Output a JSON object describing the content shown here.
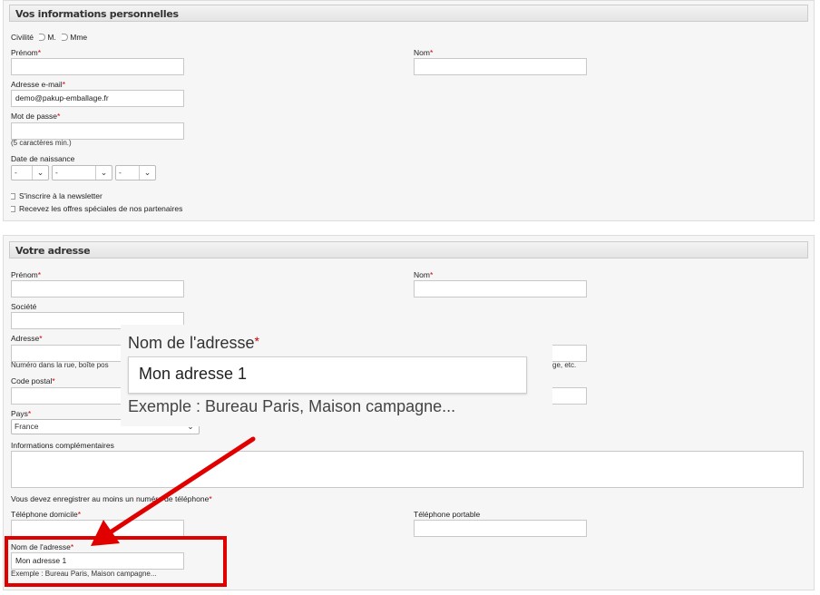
{
  "personal": {
    "header": "Vos informations personnelles",
    "civilite": "Civilité",
    "mr": "M.",
    "mme": "Mme",
    "prenom": "Prénom",
    "nom": "Nom",
    "email_label": "Adresse e-mail",
    "email_value": "demo@pakup-emballage.fr",
    "password_label": "Mot de passe",
    "password_hint": "(5 caractères min.)",
    "birth_label": "Date de naissance",
    "day": "-",
    "month": "-",
    "year": "-",
    "newsletter": "S'inscrire à la newsletter",
    "offers": "Recevez les offres spéciales de nos partenaires"
  },
  "address": {
    "header": "Votre adresse",
    "prenom": "Prénom",
    "nom": "Nom",
    "societe": "Société",
    "adresse": "Adresse",
    "adresse_hint": "Numéro dans la rue, boîte pos",
    "adresse2_hint_tail": "ge, etc.",
    "code_postal": "Code postal",
    "pays": "Pays",
    "pays_value": "France",
    "infos": "Informations complémentaires",
    "phone_note": "Vous devez enregistrer au moins un numéro de téléphone",
    "tel_domicile": "Téléphone domicile",
    "tel_portable": "Téléphone portable",
    "alias_label": "Nom de l'adresse",
    "alias_value": "Mon adresse 1",
    "alias_hint": "Exemple : Bureau Paris, Maison campagne..."
  },
  "required_mark": "*",
  "colors": {
    "annotation_red": "#e10000",
    "required": "#cc0000"
  },
  "icons": {
    "dropdown": "chevron-down-icon",
    "arrow": "red-arrow-annotation"
  }
}
